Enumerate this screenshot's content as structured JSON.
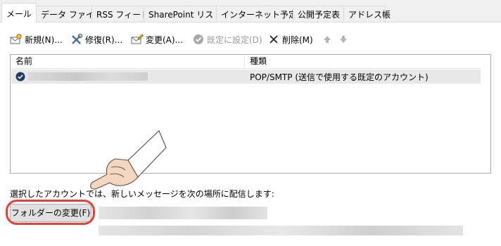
{
  "tabs": [
    "メール",
    "データ ファイル",
    "RSS フィード",
    "SharePoint リスト",
    "インターネット予定表",
    "公開予定表",
    "アドレス帳"
  ],
  "toolbar": {
    "new_label": "新規(N)...",
    "repair_label": "修復(R)...",
    "change_label": "変更(A)...",
    "set_default_label": "既定に設定(D)",
    "delete_label": "削除(M)"
  },
  "accounts_table": {
    "headers": [
      "名前",
      "種類"
    ],
    "rows": [
      {
        "type": "POP/SMTP (送信で使用する既定のアカウント)"
      }
    ]
  },
  "delivery": {
    "description": "選択したアカウントでは、新しいメッセージを次の場所に配信します:",
    "change_folder_label": "フォルダーの変更(F)"
  },
  "colors": {
    "highlight": "#e0433a",
    "pointer_sleeve": "#ffffff",
    "pointer_skin": "#f4d7c0"
  }
}
